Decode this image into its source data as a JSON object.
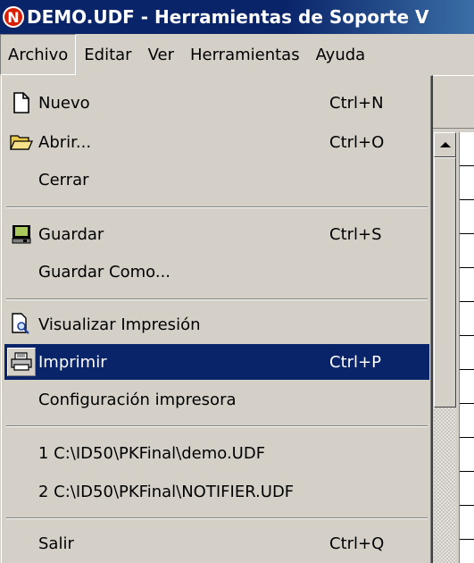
{
  "window": {
    "title": "DEMO.UDF - Herramientas de Soporte V"
  },
  "app_icon": {
    "name": "app-logo-icon",
    "glyph": "N",
    "color": "#d81e05"
  },
  "menubar": [
    {
      "label": "Archivo",
      "open": true
    },
    {
      "label": "Editar"
    },
    {
      "label": "Ver"
    },
    {
      "label": "Herramientas"
    },
    {
      "label": "Ayuda"
    }
  ],
  "file_menu": {
    "items": [
      {
        "label": "Nuevo",
        "shortcut": "Ctrl+N",
        "icon": "new-document-icon"
      },
      {
        "label": "Abrir...",
        "shortcut": "Ctrl+O",
        "icon": "open-folder-icon"
      },
      {
        "label": "Cerrar",
        "shortcut": ""
      },
      {
        "label": "Guardar",
        "shortcut": "Ctrl+S",
        "icon": "save-disk-icon"
      },
      {
        "label": "Guardar Como...",
        "shortcut": ""
      },
      {
        "label": "Visualizar Impresión",
        "shortcut": "",
        "icon": "print-preview-icon"
      },
      {
        "label": "Imprimir",
        "shortcut": "Ctrl+P",
        "icon": "printer-icon",
        "highlighted": true
      },
      {
        "label": "Configuración impresora",
        "shortcut": ""
      },
      {
        "label": "1 C:\\ID50\\PKFinal\\demo.UDF",
        "shortcut": ""
      },
      {
        "label": "2 C:\\ID50\\PKFinal\\NOTIFIER.UDF",
        "shortcut": ""
      },
      {
        "label": "Salir",
        "shortcut": "Ctrl+Q"
      }
    ]
  },
  "colors": {
    "highlight": "#0a246a",
    "face": "#d4d0c8",
    "titlebar": "#0a246a"
  }
}
